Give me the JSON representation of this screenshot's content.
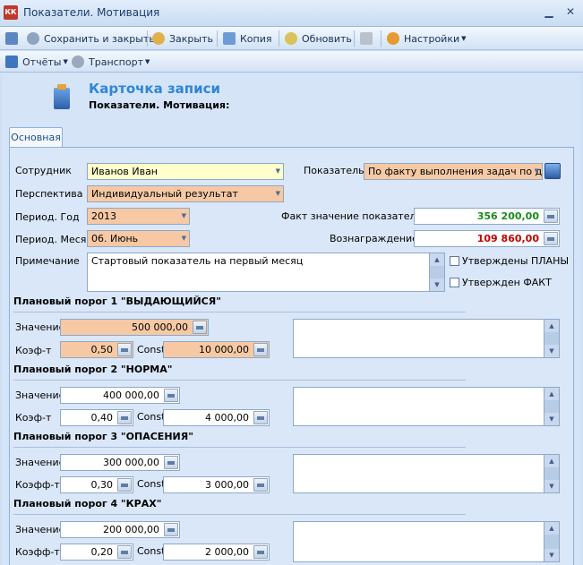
{
  "window": {
    "app_badge": "КК",
    "title": "Показатели. Мотивация"
  },
  "toolbar": {
    "save_close": "Сохранить и закрыть",
    "close": "Закрыть",
    "copy": "Копия",
    "refresh": "Обновить",
    "settings": "Настройки"
  },
  "toolbar2": {
    "reports": "Отчёты",
    "transport": "Транспорт"
  },
  "card": {
    "title": "Карточка записи",
    "subtitle": "Показатели. Мотивация:"
  },
  "tab": "Основная",
  "form": {
    "employee_label": "Сотрудник",
    "employee": "Иванов Иван",
    "indicator_label": "Показатель",
    "indicator": "По факту выполнения задач по дог",
    "perspective_label": "Перспектива",
    "perspective": "Индивидуальный результат",
    "year_label": "Период. Год",
    "year": "2013",
    "fact_label": "Факт значение показателя",
    "fact": "356 200,00",
    "month_label": "Период. Месяц",
    "month": "06. Июнь",
    "reward_label": "Вознаграждение",
    "reward": "109 860,00",
    "note_label": "Примечание",
    "note": "Стартовый показатель на первый месяц",
    "plans_approved": "Утверждены ПЛАНЫ",
    "fact_approved": "Утвержден ФАКТ"
  },
  "thresholds": [
    {
      "title": "Плановый порог 1 \"ВЫДАЮЩИЙСЯ\"",
      "value_label": "Значение",
      "value": "500 000,00",
      "coef_label": "Коэф-т",
      "coef": "0,50",
      "const_label": "Const",
      "const": "10 000,00"
    },
    {
      "title": "Плановый порог 2 \"НОРМА\"",
      "value_label": "Значение",
      "value": "400 000,00",
      "coef_label": "Коэф-т",
      "coef": "0,40",
      "const_label": "Const",
      "const": "4 000,00"
    },
    {
      "title": "Плановый порог 3 \"ОПАСЕНИЯ\"",
      "value_label": "Значение",
      "value": "300 000,00",
      "coef_label": "Коэфф-т",
      "coef": "0,30",
      "const_label": "Const",
      "const": "3 000,00"
    },
    {
      "title": "Плановый порог 4 \"КРАХ\"",
      "value_label": "Значение",
      "value": "200 000,00",
      "coef_label": "Коэфф-т",
      "coef": "0,20",
      "const_label": "Const",
      "const": "2 000,00"
    }
  ],
  "colors": {
    "accent": "#2e86d6",
    "peach": "#f6c9a4",
    "highlight": "#ffffcc",
    "fact": "#1a8a1a",
    "reward": "#c00000"
  }
}
